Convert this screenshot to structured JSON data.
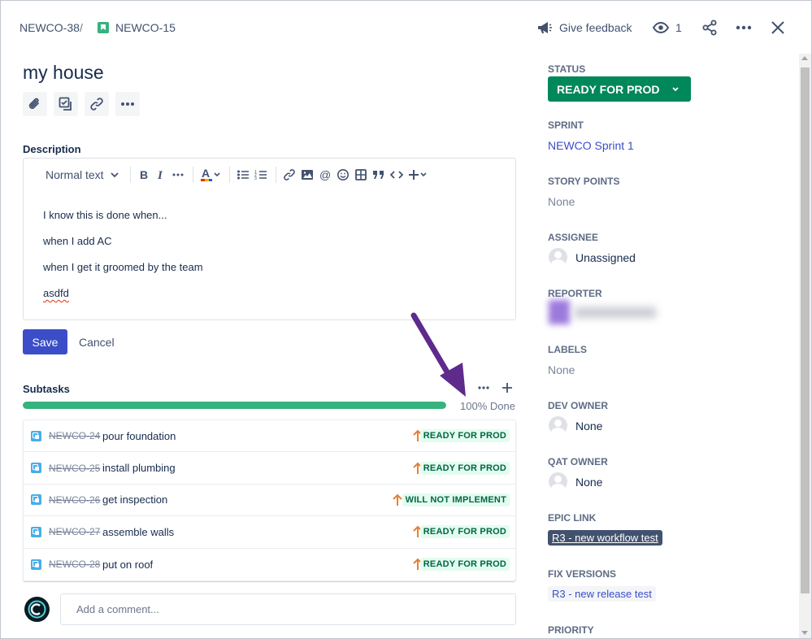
{
  "breadcrumb": {
    "parent": "NEWCO-38",
    "separator": "/",
    "issue": "NEWCO-15"
  },
  "header": {
    "feedback_label": "Give feedback",
    "watch_count": "1"
  },
  "issue": {
    "title": "my house"
  },
  "description": {
    "label": "Description",
    "text_style": "Normal text",
    "paragraphs": [
      "I know this is done when...",
      "when I add AC",
      "when I get it groomed by the team",
      "asdfd"
    ],
    "save_label": "Save",
    "cancel_label": "Cancel"
  },
  "subtasks": {
    "label": "Subtasks",
    "progress_percent": 100,
    "progress_text": "100% Done",
    "items": [
      {
        "key": "NEWCO-24",
        "summary": "pour foundation",
        "status": "READY FOR PROD"
      },
      {
        "key": "NEWCO-25",
        "summary": "install plumbing",
        "status": "READY FOR PROD"
      },
      {
        "key": "NEWCO-26",
        "summary": "get inspection",
        "status": "WILL NOT IMPLEMENT"
      },
      {
        "key": "NEWCO-27",
        "summary": "assemble walls",
        "status": "READY FOR PROD"
      },
      {
        "key": "NEWCO-28",
        "summary": "put on roof",
        "status": "READY FOR PROD"
      }
    ]
  },
  "comment": {
    "placeholder": "Add a comment..."
  },
  "details": {
    "status_label": "STATUS",
    "status_value": "READY FOR PROD",
    "sprint_label": "SPRINT",
    "sprint_value": "NEWCO Sprint 1",
    "story_points_label": "STORY POINTS",
    "story_points_value": "None",
    "assignee_label": "ASSIGNEE",
    "assignee_value": "Unassigned",
    "reporter_label": "REPORTER",
    "labels_label": "LABELS",
    "labels_value": "None",
    "dev_owner_label": "DEV OWNER",
    "dev_owner_value": "None",
    "qat_owner_label": "QAT OWNER",
    "qat_owner_value": "None",
    "epic_link_label": "EPIC LINK",
    "epic_link_value": "R3 - new workflow test",
    "fix_versions_label": "FIX VERSIONS",
    "fix_versions_value": "R3 - new release test",
    "priority_label": "PRIORITY"
  },
  "colors": {
    "status_green": "#00875a",
    "primary_blue": "#3b4ec8",
    "progress_green": "#36b37e",
    "priority_orange": "#e97f33",
    "annotation_purple": "#5e2a8c"
  }
}
